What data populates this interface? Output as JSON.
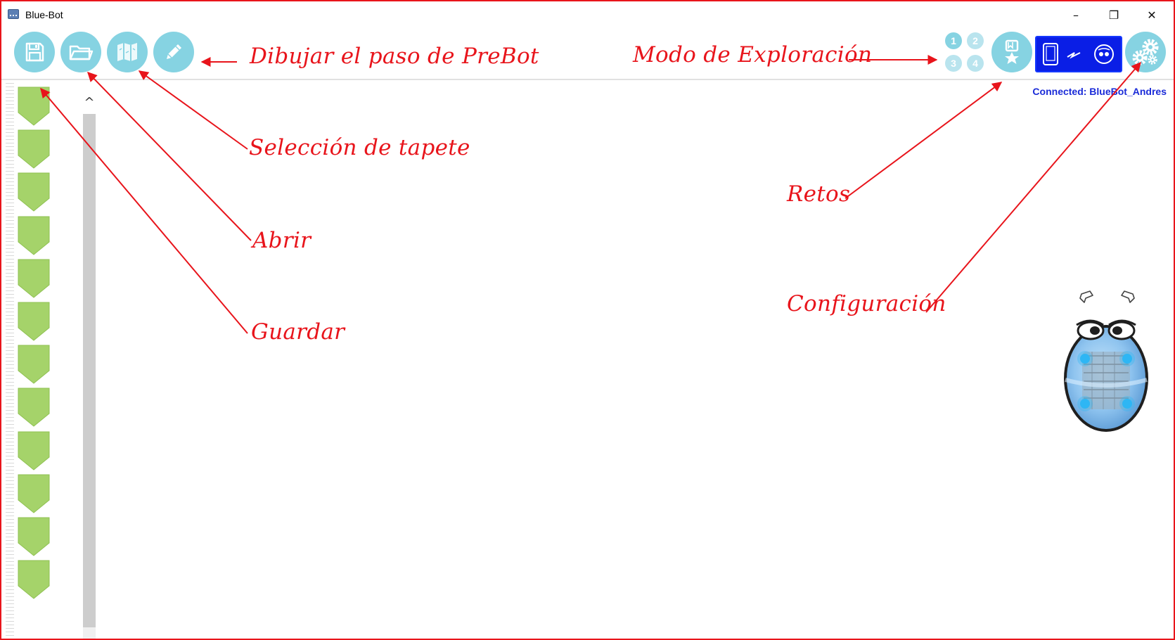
{
  "window": {
    "title": "Blue-Bot",
    "minimize_glyph": "–",
    "maximize_glyph": "❐",
    "close_glyph": "✕"
  },
  "toolbar": {
    "buttons": [
      {
        "name": "save",
        "icon": "floppy-disk-icon"
      },
      {
        "name": "open",
        "icon": "folder-icon"
      },
      {
        "name": "mats",
        "icon": "map-icon"
      },
      {
        "name": "draw",
        "icon": "pencil-icon"
      },
      {
        "name": "challenges",
        "icon": "award-ribbon-icon"
      },
      {
        "name": "settings",
        "icon": "gears-icon"
      }
    ],
    "levels": [
      "1",
      "2",
      "3",
      "4"
    ],
    "explore_mode_icon": "tablet-bluetooth-robot-icon"
  },
  "status": {
    "connected": "Connected: BlueBot_Andres"
  },
  "program": {
    "step_count": 12,
    "step_icon": "green-empty-step-icon",
    "scroll_up_glyph": "^"
  },
  "robot": {
    "turn_left_icon": "rotate-left-icon",
    "turn_right_icon": "rotate-right-icon"
  },
  "annotations": {
    "draw": "Dibujar el paso de PreBot",
    "explore": "Modo de Exploración",
    "mats": "Selección de tapete",
    "challenges": "Retos",
    "open": "Abrir",
    "settings": "Configuración",
    "save": "Guardar"
  },
  "colors": {
    "annotation": "#e8141b",
    "button": "#86d3e2",
    "step": "#a5d36a",
    "explore_bg": "#0a1ee6",
    "connected_text": "#1a2bd8"
  }
}
